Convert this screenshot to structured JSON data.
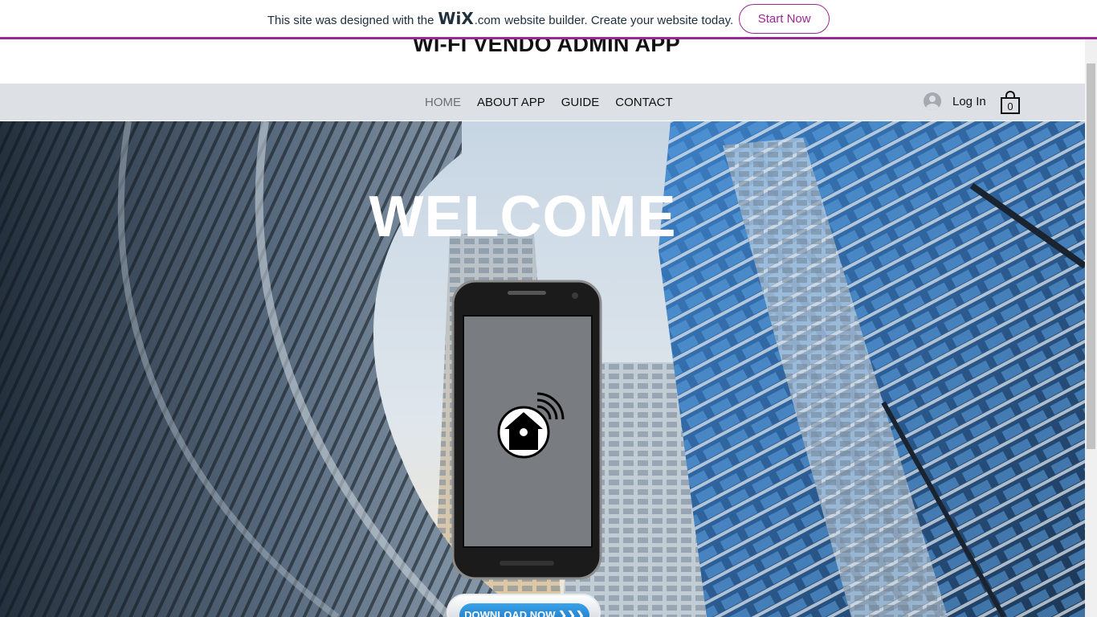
{
  "banner": {
    "text_before": "This site was designed with the",
    "logo": "WiX",
    "logo_suffix": ".com",
    "text_after": "website builder. Create your website today.",
    "cta_label": "Start Now",
    "accent_color": "#9a2795"
  },
  "header": {
    "title": "WI-FI VENDO ADMIN APP"
  },
  "nav": {
    "items": [
      {
        "label": "HOME",
        "active": true
      },
      {
        "label": "ABOUT APP",
        "active": false
      },
      {
        "label": "GUIDE",
        "active": false
      },
      {
        "label": "CONTACT",
        "active": false
      }
    ],
    "login_label": "Log In",
    "login_icon": "user-avatar-icon",
    "cart_icon": "shopping-bag-icon",
    "cart_count": "0"
  },
  "hero": {
    "heading": "WELCOME",
    "download_label": "DOWNLOAD NOW ❯❯❯",
    "phone_icon": "home-wifi-icon"
  }
}
